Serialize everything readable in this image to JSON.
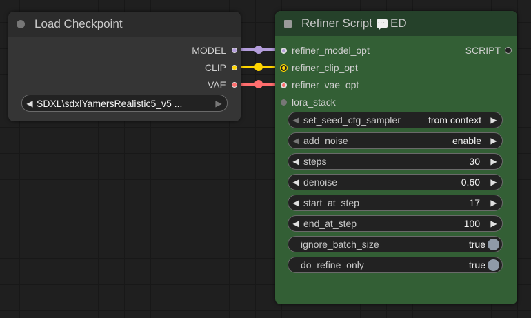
{
  "load_checkpoint": {
    "title": "Load Checkpoint",
    "outputs": [
      {
        "label": "MODEL",
        "color": "#b39ddb"
      },
      {
        "label": "CLIP",
        "color": "#ffd500"
      },
      {
        "label": "VAE",
        "color": "#ff6e6e"
      }
    ],
    "ckpt_value": "SDXL\\sdxlYamersRealistic5_v5 ..."
  },
  "refiner_script": {
    "title": "Refiner Script",
    "title_suffix": "ED",
    "output_label": "SCRIPT",
    "inputs": [
      {
        "label": "refiner_model_opt",
        "color": "#b39ddb"
      },
      {
        "label": "refiner_clip_opt",
        "color": "#ffd500"
      },
      {
        "label": "refiner_vae_opt",
        "color": "#ff6e6e"
      },
      {
        "label": "lora_stack",
        "color": "#888888"
      }
    ],
    "widgets": [
      {
        "name": "set_seed_cfg_sampler",
        "value": "from context",
        "kind": "combo",
        "left_disabled": true
      },
      {
        "name": "add_noise",
        "value": "enable",
        "kind": "combo",
        "left_disabled": true
      },
      {
        "name": "steps",
        "value": "30",
        "kind": "number"
      },
      {
        "name": "denoise",
        "value": "0.60",
        "kind": "number"
      },
      {
        "name": "start_at_step",
        "value": "17",
        "kind": "number"
      },
      {
        "name": "end_at_step",
        "value": "100",
        "kind": "number"
      },
      {
        "name": "ignore_batch_size",
        "value": "true",
        "kind": "toggle"
      },
      {
        "name": "do_refine_only",
        "value": "true",
        "kind": "toggle"
      }
    ]
  },
  "arrows": {
    "left": "◀",
    "right": "▶"
  }
}
